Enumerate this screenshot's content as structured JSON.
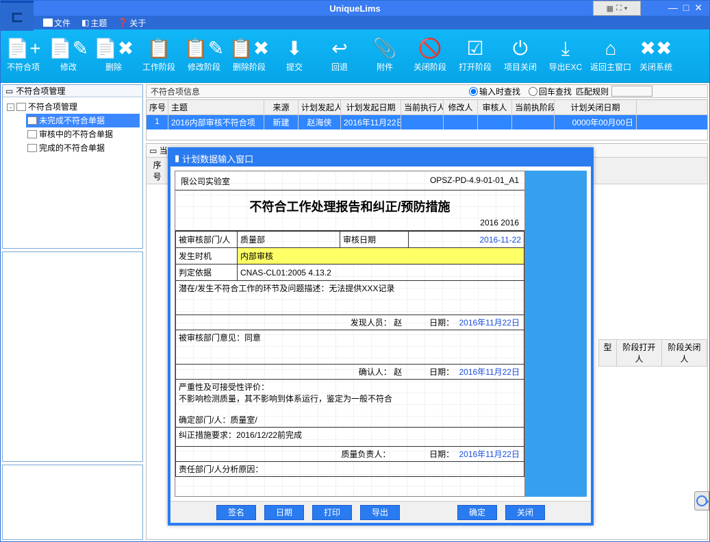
{
  "app_title": "UniqueLims",
  "window_controls": {
    "min": "—",
    "max": "□",
    "close": "✕"
  },
  "expand_grid_icon": "⛶",
  "menu": {
    "file": "文件",
    "theme": "主题",
    "about": "关于"
  },
  "toolbar": [
    {
      "name": "ncr",
      "icon": "📄+",
      "label": "不符合项"
    },
    {
      "name": "edit",
      "icon": "📄✎",
      "label": "修改"
    },
    {
      "name": "delete",
      "icon": "📄✖",
      "label": "删除"
    },
    {
      "name": "work",
      "icon": "📋",
      "label": "工作阶段"
    },
    {
      "name": "editph",
      "icon": "📋✎",
      "label": "修改阶段"
    },
    {
      "name": "delph",
      "icon": "📋✖",
      "label": "删除阶段"
    },
    {
      "name": "submit",
      "icon": "⬇",
      "label": "提交"
    },
    {
      "name": "back",
      "icon": "↩",
      "label": "回退"
    },
    {
      "name": "attach",
      "icon": "📎",
      "label": "附件"
    },
    {
      "name": "closeph",
      "icon": "🚫",
      "label": "关闭阶段"
    },
    {
      "name": "openph",
      "icon": "☑",
      "label": "打开阶段"
    },
    {
      "name": "prjclose",
      "icon": "⏻",
      "label": "项目关闭"
    },
    {
      "name": "export",
      "icon": "⤓",
      "label": "导出EXC"
    },
    {
      "name": "home",
      "icon": "⌂",
      "label": "返回主窗口"
    },
    {
      "name": "exit",
      "icon": "✖✖",
      "label": "关闭系统"
    }
  ],
  "tree_panel_title": "不符合项管理",
  "tree": {
    "root": "不符合项管理",
    "children": [
      {
        "label": "未完成不符合单据",
        "selected": true
      },
      {
        "label": "审核中的不符合单据",
        "selected": false
      },
      {
        "label": "完成的不符合单据",
        "selected": false
      }
    ]
  },
  "info_bar": {
    "label": "不符合项信息",
    "radio_type_search": "输入时查找",
    "radio_enter_search": "回车查找",
    "match_rule": "匹配规则"
  },
  "grid": {
    "headers": {
      "idx": "序号",
      "subject": "主题",
      "source": "来源",
      "initiator": "计划发起人",
      "start_date": "计划发起日期",
      "executor": "当前执行人",
      "modifier": "修改人",
      "auditor": "审核人",
      "stage": "当前执阶段",
      "close_date": "计划关闭日期"
    },
    "row": {
      "idx": "1",
      "subject": "2016内部审核不符合项",
      "source": "新建",
      "initiator": "赵海侠",
      "start_date": "2016年11月22日",
      "executor": "",
      "modifier": "",
      "auditor": "",
      "stage": "",
      "close_date": "0000年00月00日"
    }
  },
  "lower_bar_label": "当",
  "lower_headers": {
    "idx": "序号"
  },
  "peek_headers": {
    "col1": "型",
    "col2": "阶段打开人",
    "col3": "阶段关闭人"
  },
  "modal": {
    "title": "计划数据输入窗口",
    "org": "限公司实验室",
    "doc_code": "OPSZ-PD-4.9-01-01_A1",
    "main_title": "不符合工作处理报告和纠正/预防措施",
    "year": "2016 2016",
    "t_audited_dept": "被审核部门/人",
    "v_audited_dept": "质量部",
    "t_audit_date": "审核日期",
    "v_audit_date": "2016-11-22",
    "t_timing": "发生时机",
    "v_timing": "内部审核",
    "t_basis": "判定依据",
    "v_basis": "CNAS-CL01:2005 4.13.2",
    "desc_label": "潜在/发生不符合工作的环节及问题描述：无法提供XXX记录",
    "discoverer_label": "发现人员：",
    "discoverer": "赵",
    "date_label": "日期：",
    "disc_date": "2016年11月22日",
    "opinion_label": "被审核部门意见：同意",
    "confirm_label": "确认人：",
    "confirm_person": "赵",
    "confirm_date": "2016年11月22日",
    "severity_label": "严重性及可接受性评价：",
    "severity_text": "不影响检测质量，其不影响到体系运行，鉴定为一般不符合",
    "confirm_dept_label": "确定部门/人：质量室/",
    "correction_label": "纠正措施要求：2016/12/22前完成",
    "qm_label": "质量负责人：",
    "qm_date": "2016年11月22日",
    "resp_label": "责任部门/人分析原因：",
    "buttons": {
      "sign": "签名",
      "date": "日期",
      "print": "打印",
      "export": "导出",
      "ok": "确定",
      "close": "关闭"
    }
  }
}
